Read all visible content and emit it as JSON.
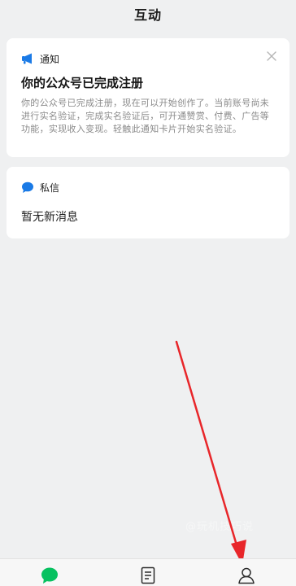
{
  "header": {
    "title": "互动"
  },
  "notice_card": {
    "label": "通知",
    "icon": "megaphone-icon",
    "title": "你的公众号已完成注册",
    "body": "你的公众号已完成注册，现在可以开始创作了。当前账号尚未进行实名验证，完成实名验证后，可开通赞赏、付费、广告等功能，实现收入变现。轻触此通知卡片开始实名验证。"
  },
  "message_card": {
    "label": "私信",
    "icon": "chat-bubble-icon",
    "empty_text": "暂无新消息"
  },
  "watermark": {
    "text": "@玩机技巧说"
  },
  "tabbar": {
    "items": [
      {
        "icon": "chat-bubble-icon",
        "active": true
      },
      {
        "icon": "document-icon",
        "active": false
      },
      {
        "icon": "person-icon",
        "active": false
      }
    ]
  },
  "colors": {
    "accent_green": "#07c160",
    "accent_blue": "#1a7ae6",
    "annotation_arrow": "#e8262a"
  }
}
